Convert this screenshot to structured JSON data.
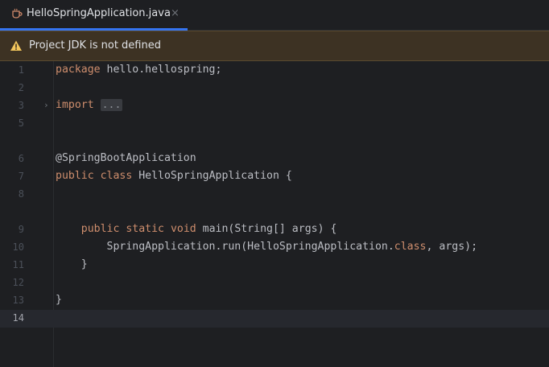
{
  "tab": {
    "label": "HelloSpringApplication.java",
    "close": "×",
    "icon": "java-file-icon"
  },
  "banner": {
    "icon": "warning-icon",
    "text": "Project JDK is not defined"
  },
  "colors": {
    "accent": "#3574f0",
    "keyword": "#cf8e6d",
    "annotation": "#b3ae60",
    "text": "#bcbec4",
    "warning": "#f2c55c"
  },
  "editor": {
    "fold_marker": "›",
    "current_line": "14",
    "lines": [
      {
        "num": "1",
        "tokens": {
          "t0": "package",
          "t1": " hello.hellospring;"
        }
      },
      {
        "num": "2"
      },
      {
        "num": "3",
        "tokens": {
          "t0": "import",
          "t1": " ",
          "t2": "..."
        }
      },
      {
        "num": "5"
      },
      {
        "num": "6",
        "tokens": {
          "t0": "@SpringBootApplication"
        }
      },
      {
        "num": "7",
        "tokens": {
          "t0": "public",
          "t1": " ",
          "t2": "class",
          "t3": " HelloSpringApplication {"
        }
      },
      {
        "num": "8"
      },
      {
        "num": "9",
        "tokens": {
          "t0": "    ",
          "t1": "public",
          "t2": " ",
          "t3": "static",
          "t4": " ",
          "t5": "void",
          "t6": " main(String[] args) {"
        }
      },
      {
        "num": "10",
        "tokens": {
          "t0": "        SpringApplication.run(HelloSpringApplication.",
          "t1": "class",
          "t2": ", args);"
        }
      },
      {
        "num": "11",
        "tokens": {
          "t0": "    }"
        }
      },
      {
        "num": "12"
      },
      {
        "num": "13",
        "tokens": {
          "t0": "}"
        }
      },
      {
        "num": "14"
      }
    ]
  }
}
